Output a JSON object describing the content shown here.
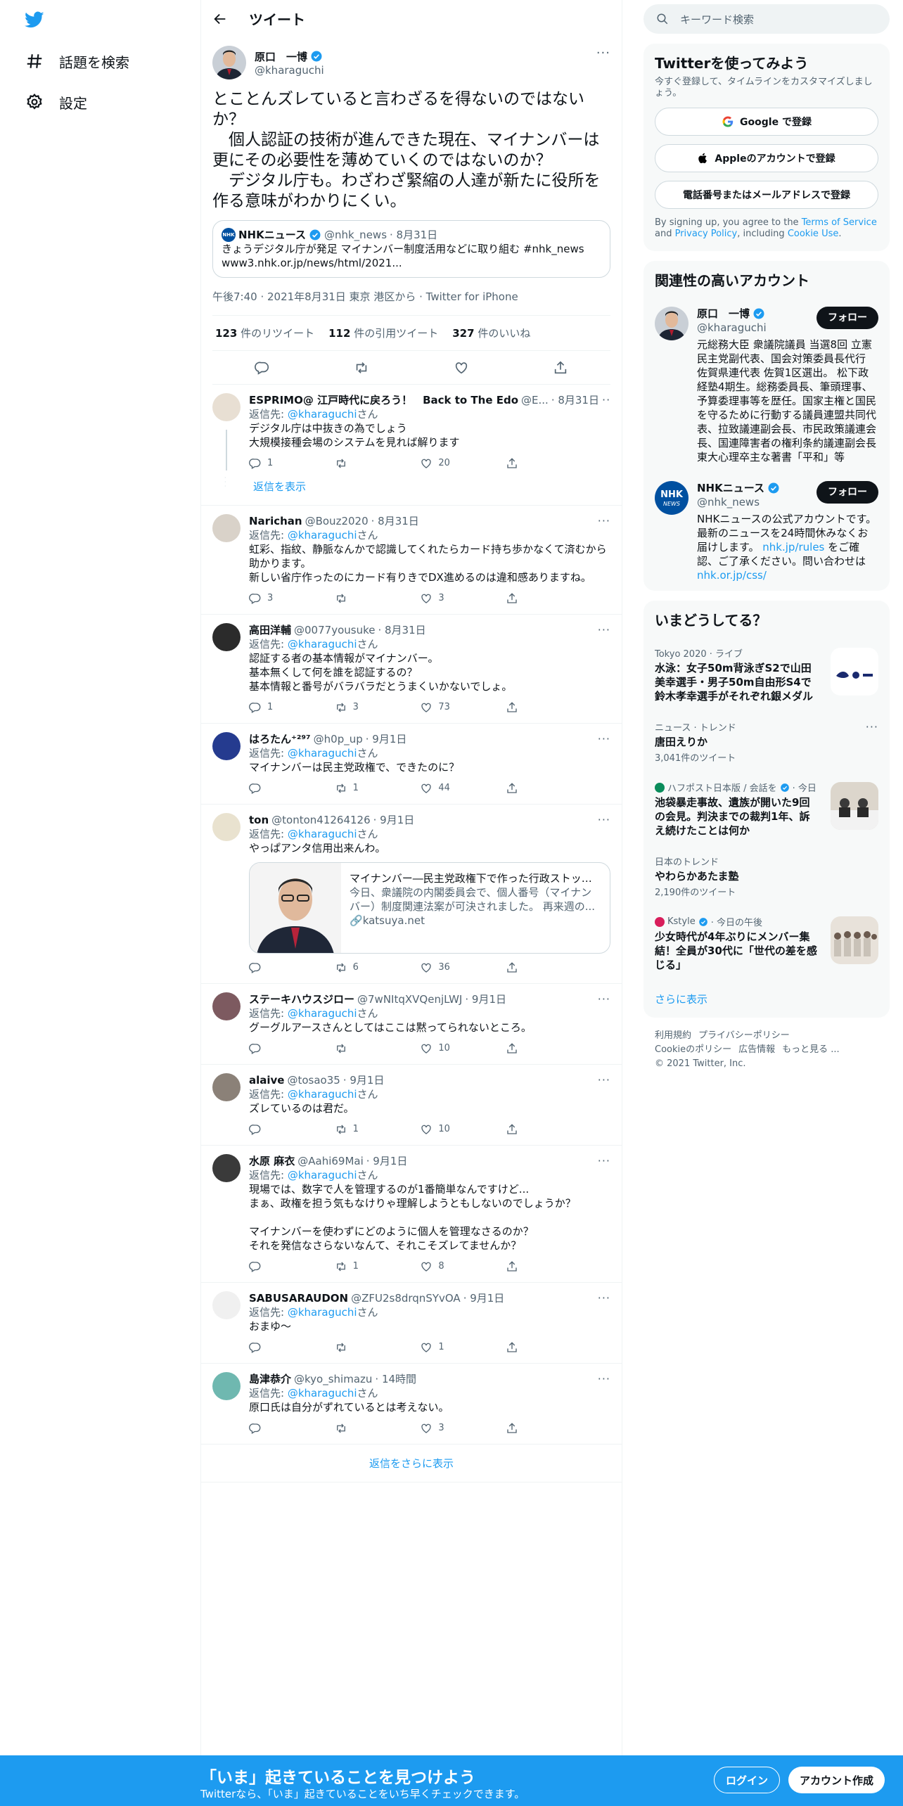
{
  "nav": {
    "explore": "話題を検索",
    "settings": "設定"
  },
  "header": {
    "title": "ツイート"
  },
  "focal": {
    "name": "原口　一博",
    "handle": "@kharaguchi",
    "text": "とことんズレていると言わざるを得ないのではないか？\n　個人認証の技術が進んできた現在、マイナンバーは更にその必要性を薄めていくのではないのか？\n　デジタル庁も。わざわざ緊縮の人達が新たに役所を作る意味がわかりにくい。",
    "quote": {
      "name": "NHKニュース",
      "handle": "@nhk_news",
      "date": "· 8月31日",
      "text": "きょうデジタル庁が発足 マイナンバー制度活用などに取り組む #nhk_news",
      "url": "www3.nhk.or.jp/news/html/2021..."
    },
    "meta": "午後7:40 · 2021年8月31日 東京 港区から · Twitter for iPhone",
    "retweets": "123",
    "retweets_label": "件のリツイート",
    "quotes": "112",
    "quotes_label": "件の引用ツイート",
    "likes": "327",
    "likes_label": "件のいいね"
  },
  "reply_to_label": "返信先: ",
  "reply_to_handle": "@kharaguchi",
  "reply_to_suffix": "さん",
  "show_replies": "返信を表示",
  "replies": [
    {
      "name": "ESPRIMO@ 江戸時代に戻ろう！　Back to The Edo",
      "handle": "@E...",
      "date": "· 8月31日",
      "text": "デジタル庁は中抜きの為でしょう\n大規模接種会場のシステムを見れば解ります",
      "reply": "1",
      "retweet": "",
      "like": "20"
    },
    {
      "name": "Narichan",
      "handle": "@Bouz2020",
      "date": "· 8月31日",
      "text": "虹彩、指紋、静脈なんかで認識してくれたらカード持ち歩かなくて済むから助かります。\n新しい省庁作ったのにカード有りきでDX進めるのは違和感ありますね。",
      "reply": "3",
      "retweet": "",
      "like": "3"
    },
    {
      "name": "高田洋輔",
      "handle": "@0077yousuke",
      "date": "· 8月31日",
      "text": "認証する者の基本情報がマイナンバー。\n基本無くして何を誰を認証するの？\n基本情報と番号がバラバラだとうまくいかないでしょ。",
      "reply": "1",
      "retweet": "3",
      "like": "73"
    },
    {
      "name": "はろたん⁺²⁹⁷",
      "handle": "@h0p_up",
      "date": "· 9月1日",
      "text": "マイナンバーは民主党政権で、できたのに？",
      "reply": "",
      "retweet": "1",
      "like": "44"
    },
    {
      "name": "ton",
      "handle": "@tonton41264126",
      "date": "· 9月1日",
      "text": "やっぱアンタ信用出来んわ。",
      "reply": "",
      "retweet": "6",
      "like": "36",
      "card": {
        "title": "マイナンバー―民主党政権下で作った行政ストック...",
        "desc": "今日、衆議院の内閣委員会で、個人番号（マイナンバー）制度関連法案が可決されました。 再来週の...",
        "domain": "katsuya.net"
      }
    },
    {
      "name": "ステーキハウスジロー",
      "handle": "@7wNItqXVQenjLWJ",
      "date": "· 9月1日",
      "text": "グーグルアースさんとしてはここは黙ってられないところ。",
      "reply": "",
      "retweet": "",
      "like": "10"
    },
    {
      "name": "alaive",
      "handle": "@tosao35",
      "date": "· 9月1日",
      "text": "ズレているのは君だ。",
      "reply": "",
      "retweet": "1",
      "like": "10"
    },
    {
      "name": "水原 麻衣",
      "handle": "@Aahi69Mai",
      "date": "· 9月1日",
      "text": "現場では、数字で人を管理するのが1番簡単なんですけど...\nまぁ、政権を担う気もなけりゃ理解しようともしないのでしょうか？\n\nマイナンバーを使わずにどのように個人を管理なさるのか？\nそれを発信なさらないなんて、それこそズレてませんか？",
      "reply": "",
      "retweet": "1",
      "like": "8"
    },
    {
      "name": "SABUSARAUDON",
      "handle": "@ZFU2s8drqnSYvOA",
      "date": "· 9月1日",
      "text": "おまゆ〜",
      "reply": "",
      "retweet": "",
      "like": "1"
    },
    {
      "name": "島津恭介",
      "handle": "@kyo_shimazu",
      "date": "· 14時間",
      "text": "原口氏は自分がずれているとは考えない。",
      "reply": "",
      "retweet": "",
      "like": "3"
    }
  ],
  "show_more_replies": "返信をさらに表示",
  "search": {
    "placeholder": "キーワード検索"
  },
  "signup": {
    "title": "Twitterを使ってみよう",
    "sub": "今すぐ登録して、タイムラインをカスタマイズしましょう。",
    "google": "Google で登録",
    "apple": "Appleのアカウントで登録",
    "phone": "電話番号またはメールアドレスで登録",
    "terms_a": "By signing up, you agree to the ",
    "terms_tos": "Terms of Service",
    "terms_b": " and ",
    "terms_pp": "Privacy Policy",
    "terms_c": ", including ",
    "terms_cookie": "Cookie Use",
    "terms_d": "."
  },
  "relevant": {
    "title": "関連性の高いアカウント",
    "follow": "フォロー",
    "accounts": [
      {
        "name": "原口　一博",
        "handle": "@kharaguchi",
        "bio": "元総務大臣 衆議院議員 当選8回 立憲民主党副代表、国会対策委員長代行 佐賀県連代表 佐賀1区選出。 松下政経塾4期生。総務委員長、筆頭理事、予算委理事等を歴任。国家主権と国民を守るために行動する議員連盟共同代表、拉致議連副会長、市民政策議連会長、国連障害者の権利条約議連副会長 東大心理卒主な著書「平和」等"
      },
      {
        "name": "NHKニュース",
        "handle": "@nhk_news",
        "bio": "NHKニュースの公式アカウントです。最新のニュースを24時間休みなくお届けします。 ",
        "bio_link": "nhk.jp/rules",
        "bio_2": " をご確認、ご了承ください。問い合わせは ",
        "bio_link2": "nhk.or.jp/css/"
      }
    ]
  },
  "trends": {
    "title": "いまどうしてる？",
    "items": [
      {
        "meta": "Tokyo 2020 · ライブ",
        "title": "水泳：女子50m背泳ぎS2で山田美幸選手・男子50m自由形S4で鈴木孝幸選手がそれぞれ銀メダル"
      },
      {
        "meta": "ニュース · トレンド",
        "title": "唐田えりか",
        "count": "3,041件のツイート"
      },
      {
        "meta": "ハフポスト日本版 / 会話を",
        "meta2": "· 今日",
        "title": "池袋暴走事故、遺族が開いた9回の会見。判決までの裁判1年、訴え続けたことは何か"
      },
      {
        "meta": "日本のトレンド",
        "title": "やわらかあたま塾",
        "count": "2,190件のツイート"
      },
      {
        "meta": "Kstyle",
        "meta2": "· 今日の午後",
        "title": "少女時代が4年ぶりにメンバー集結！全員が30代に「世代の差を感じる」"
      }
    ],
    "more": "さらに表示"
  },
  "footer": {
    "l1": "利用規約",
    "l2": "プライバシーポリシー",
    "l3": "Cookieのポリシー",
    "l4": "広告情報",
    "l5": "もっと見る ...",
    "copy": "© 2021 Twitter, Inc."
  },
  "banner": {
    "title": "「いま」起きていることを見つけよう",
    "sub": "Twitterなら、「いま」起きていることをいち早くチェックできます。",
    "login": "ログイン",
    "signup": "アカウント作成"
  },
  "colors": {
    "accent": "#1d9bf0",
    "text": "#0f1419",
    "secondary": "#536471"
  }
}
